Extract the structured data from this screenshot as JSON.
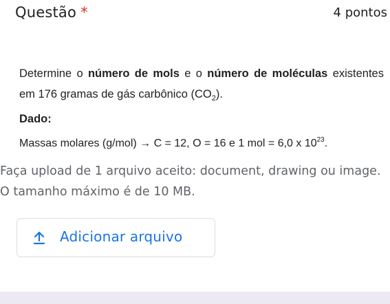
{
  "question": {
    "title": "Questão",
    "required_mark": "*",
    "points": "4 pontos",
    "text_1": "Determine o ",
    "text_bold_1": "número de mols",
    "text_2": " e o ",
    "text_bold_2": "número de moléculas",
    "text_3": " existentes em 176 gramas de gás carbônico (CO",
    "text_sub": "2",
    "text_4": ").",
    "dado_label": "Dado:",
    "massas_text": "Massas molares (g/mol) → C = 12, O = 16 e 1 mol = 6,0 x 10",
    "massas_sup": "23",
    "massas_end": "."
  },
  "upload": {
    "info": "Faça upload de 1 arquivo aceito: document, drawing ou image. O tamanho máximo é de 10 MB.",
    "button_label": "Adicionar arquivo",
    "button_icon": "upload-icon",
    "accent_color": "#1a73e8"
  }
}
